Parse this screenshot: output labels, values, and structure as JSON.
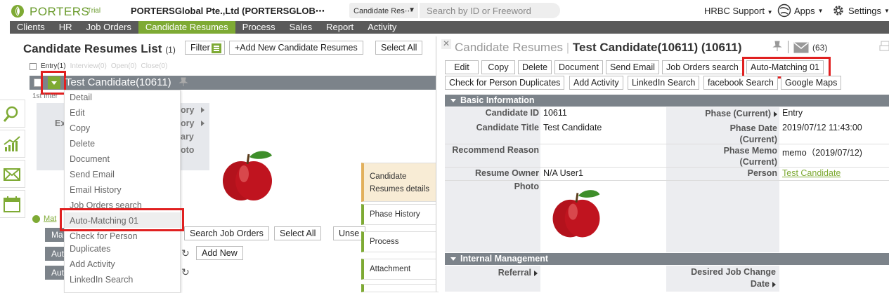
{
  "topbar": {
    "logo": "PORTERS",
    "trial": "Trial",
    "company": "PORTERSGlobal Pte.,Ltd (PORTERSGLOB⋯",
    "search_type": "Candidate Res⋯",
    "search_placeholder": "Search by ID or Freeword",
    "support": "HRBC Support",
    "apps": "Apps",
    "settings": "Settings"
  },
  "nav": [
    "Clients",
    "HR",
    "Job Orders",
    "Candidate Resumes",
    "Process",
    "Sales",
    "Report",
    "Activity"
  ],
  "nav_active": "Candidate Resumes",
  "list": {
    "title": "Candidate Resumes List",
    "count": "(1)",
    "filter": "Filter",
    "add_new": "+Add New Candidate Resumes",
    "select_all": "Select All",
    "phase_tabs": [
      "Entry(1)",
      "Interview(0)",
      "Open(0)",
      "Close(0)"
    ],
    "candidate": "Test Candidate(10611)",
    "first_interview_partial": "1st Inter",
    "faded_labels": [
      "ory",
      "Ex",
      "ory",
      "ary",
      "oto"
    ],
    "match_partial": "Mat",
    "search_job_orders": "Search Job Orders",
    "select_all_2": "Select All",
    "unselect_partial": "Unse",
    "add_new_2": "Add New",
    "row_partials": [
      "Ma",
      "Aut",
      "Aut"
    ]
  },
  "menu": {
    "items": [
      "Detail",
      "Edit",
      "Copy",
      "Delete",
      "Document",
      "Send Email",
      "Email History",
      "Job Orders search",
      "Auto-Matching 01",
      "Check for Person",
      "Duplicates",
      "Add Activity",
      "LinkedIn Search"
    ]
  },
  "mid_tabs": [
    "Candidate",
    "Resumes details",
    "Phase History",
    "Process",
    "Attachment"
  ],
  "panel": {
    "title_prefix": "Candidate Resumes",
    "title": "Test Candidate(10611) (10611)",
    "mail_count": "(63)",
    "buttons_row1": [
      "Edit",
      "Copy",
      "Delete",
      "Document",
      "Send Email",
      "Job Orders search",
      "Auto-Matching 01"
    ],
    "buttons_row2": [
      "Check for Person Duplicates",
      "Add Activity",
      "LinkedIn Search",
      "facebook Search",
      "Google Maps"
    ],
    "basic_info": "Basic Information",
    "fields": {
      "candidate_id_label": "Candidate ID",
      "candidate_id": "10611",
      "candidate_title_label": "Candidate Title",
      "candidate_title": "Test Candidate",
      "recommend_label": "Recommend Reason",
      "owner_label": "Resume Owner",
      "owner": "N/A User1",
      "photo_label": "Photo",
      "phase_label": "Phase (Current)",
      "phase": "Entry",
      "phase_date_label_1": "Phase Date",
      "phase_date_label_2": "(Current)",
      "phase_date": "2019/07/12 11:43:00",
      "phase_memo_label_1": "Phase Memo",
      "phase_memo_label_2": "(Current)",
      "phase_memo": "memo（2019/07/12)",
      "person_label": "Person",
      "person": "Test Candidate"
    },
    "internal": "Internal Management",
    "referral_label": "Referral",
    "desired_label_1": "Desired Job Change",
    "desired_label_2": "Date"
  }
}
